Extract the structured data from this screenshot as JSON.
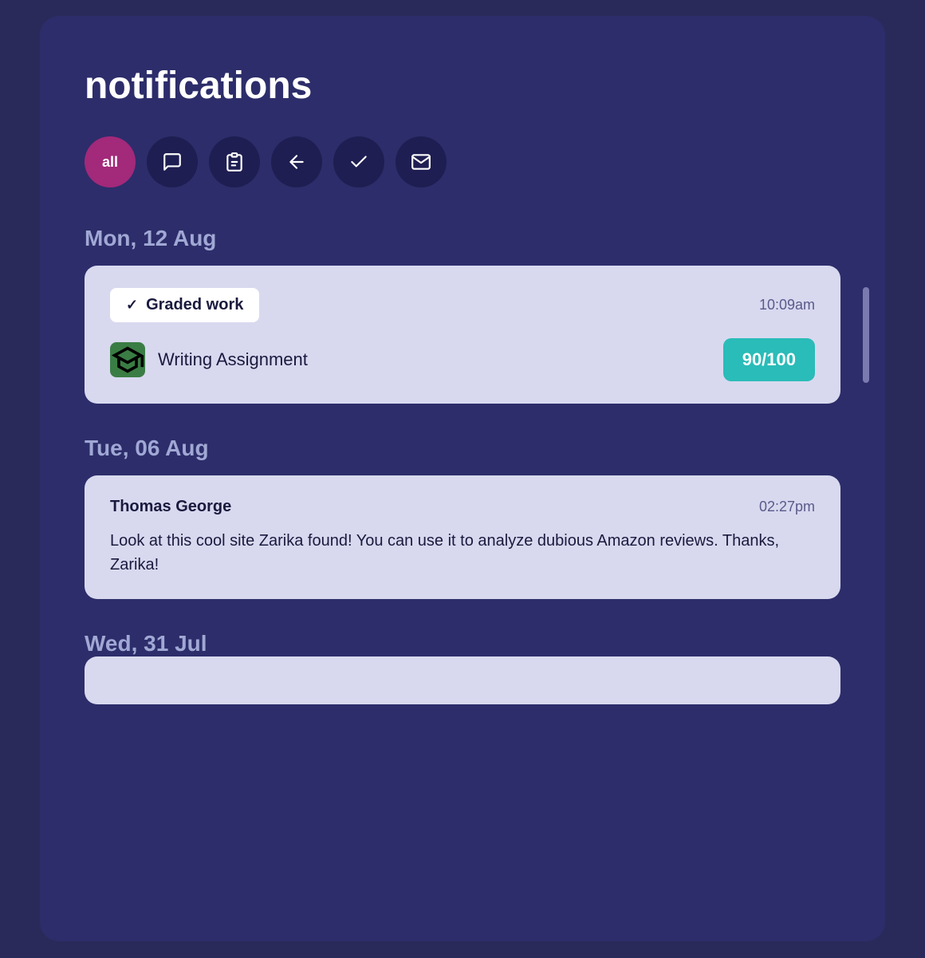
{
  "page": {
    "title": "notifications"
  },
  "filters": [
    {
      "id": "all",
      "label": "all",
      "active": true,
      "icon": "text"
    },
    {
      "id": "chat",
      "label": "",
      "active": false,
      "icon": "chat"
    },
    {
      "id": "assignments",
      "label": "",
      "active": false,
      "icon": "clipboard"
    },
    {
      "id": "back",
      "label": "",
      "active": false,
      "icon": "arrow-left"
    },
    {
      "id": "check",
      "label": "",
      "active": false,
      "icon": "check"
    },
    {
      "id": "mail",
      "label": "",
      "active": false,
      "icon": "mail"
    }
  ],
  "sections": [
    {
      "date": "Mon, 12 Aug",
      "notifications": [
        {
          "type": "graded",
          "badge_label": "Graded work",
          "time": "10:09am",
          "assignment": "Writing Assignment",
          "grade": "90/100"
        }
      ]
    },
    {
      "date": "Tue, 06 Aug",
      "notifications": [
        {
          "type": "message",
          "sender": "Thomas George",
          "time": "02:27pm",
          "message": "Look at this cool site Zarika found! You can use it to analyze dubious Amazon reviews. Thanks, Zarika!"
        }
      ]
    },
    {
      "date": "Wed, 31 Jul",
      "notifications": []
    }
  ]
}
